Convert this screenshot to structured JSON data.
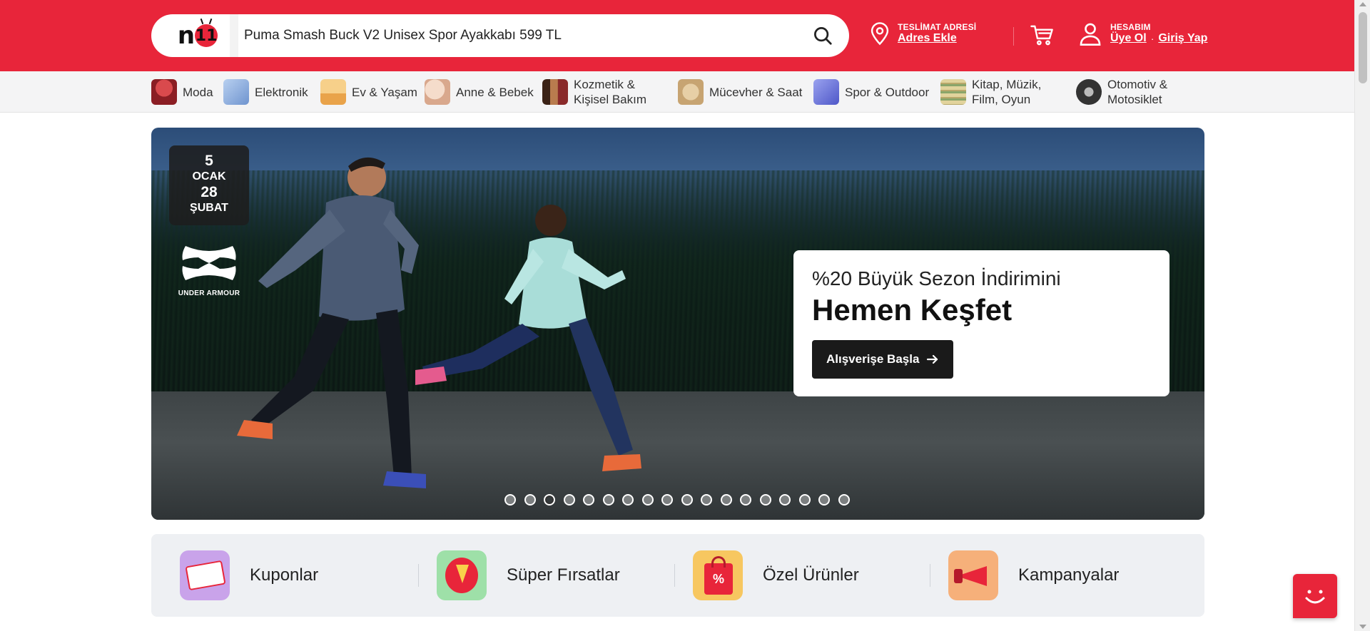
{
  "brand": {
    "logo_text": "n11"
  },
  "search": {
    "value": "Puma Smash Buck V2 Unisex Spor Ayakkabı 599 TL"
  },
  "header": {
    "address_caption": "TESLİMAT ADRESİ",
    "address_link": "Adres Ekle",
    "account_caption": "HESABIM",
    "register_link": "Üye Ol",
    "separator_dot": "·",
    "login_link": "Giriş Yap"
  },
  "categories": [
    {
      "label": "Moda",
      "color": "#c8363a"
    },
    {
      "label": "Elektronik",
      "color": "#8fb2e0"
    },
    {
      "label": "Ev & Yaşam",
      "color": "#f0b45a"
    },
    {
      "label": "Anne & Bebek",
      "color": "#e9c6b4"
    },
    {
      "label": "Kozmetik &\nKişisel Bakım",
      "color": "#7a4a32"
    },
    {
      "label": "Mücevher & Saat",
      "color": "#d8b98c"
    },
    {
      "label": "Spor & Outdoor",
      "color": "#6a72d8"
    },
    {
      "label": "Kitap, Müzik,\nFilm, Oyun",
      "color": "#cfc08e"
    },
    {
      "label": "Otomotiv &\nMotosiklet",
      "color": "#3c3c3c"
    }
  ],
  "hero": {
    "date_day1": "5",
    "date_month1": "OCAK",
    "date_day2": "28",
    "date_month2": "ŞUBAT",
    "brand_name": "UNDER ARMOUR",
    "promo_subtitle": "%20 Büyük Sezon İndirimini",
    "promo_title": "Hemen Keşfet",
    "cta_label": "Alışverişe Başla",
    "slide_count": 18,
    "active_slide": 3
  },
  "quick_links": [
    {
      "label": "Kuponlar",
      "icon": "coupon-icon",
      "color": "#c9a3ea"
    },
    {
      "label": "Süper Fırsatlar",
      "icon": "lightning-badge-icon",
      "color": "#9ee0a8"
    },
    {
      "label": "Özel Ürünler",
      "icon": "shopping-bag-icon",
      "color": "#f7c760"
    },
    {
      "label": "Kampanyalar",
      "icon": "megaphone-icon",
      "color": "#f6b07a"
    }
  ],
  "colors": {
    "brand_red": "#e8253a",
    "nav_bg": "#f4f4f5",
    "quick_bg": "#eef0f3"
  }
}
